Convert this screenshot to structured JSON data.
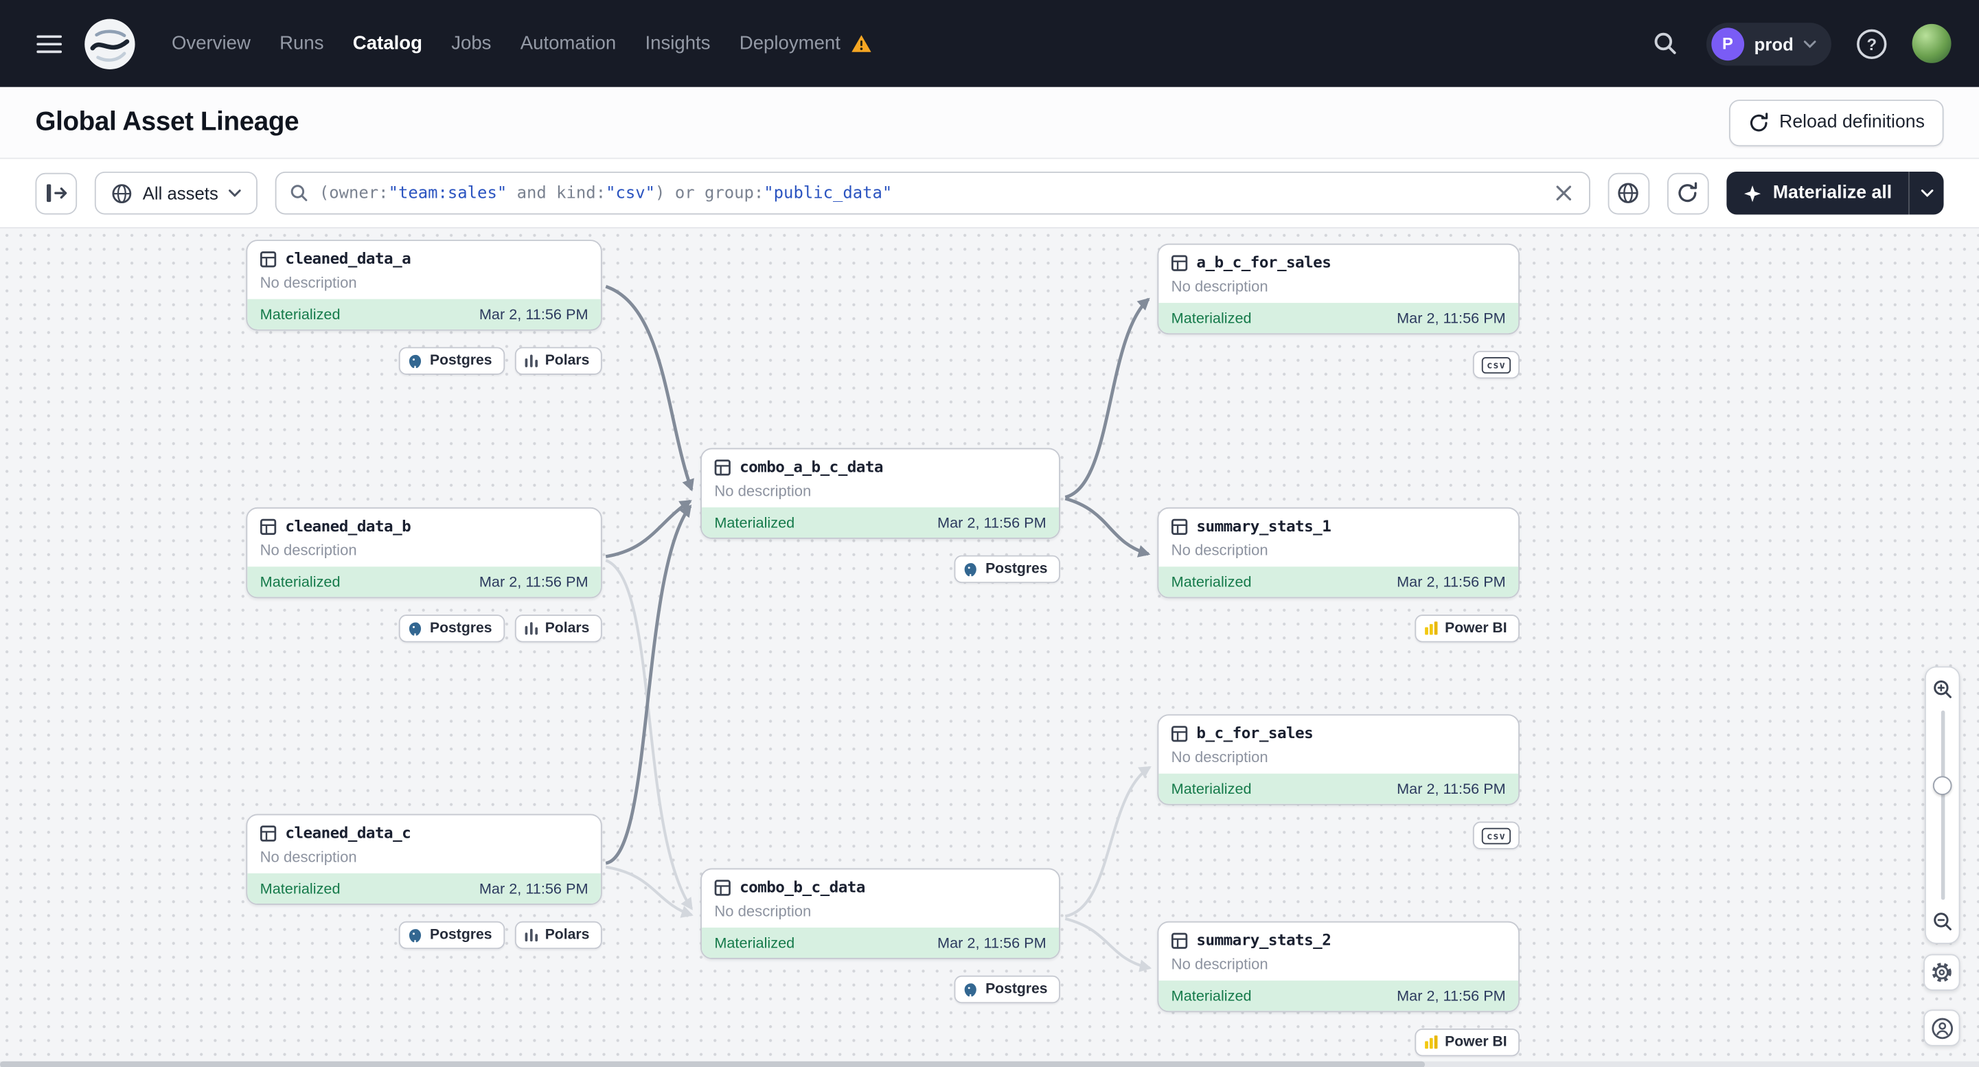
{
  "colors": {
    "nav_bg": "#171b26",
    "materialized_bg": "#d7f0e1",
    "materialized_text": "#157a4a",
    "query_string_blue": "#2b54c0",
    "warning_orange": "#f5a623",
    "materialize_button_bg": "#1e2433",
    "postgres_blue": "#336791",
    "powerbi_yellow": "#f2c811"
  },
  "nav": {
    "items": [
      {
        "label": "Overview"
      },
      {
        "label": "Runs"
      },
      {
        "label": "Catalog"
      },
      {
        "label": "Jobs"
      },
      {
        "label": "Automation"
      },
      {
        "label": "Insights"
      },
      {
        "label": "Deployment"
      }
    ],
    "deployment_pill": {
      "initial": "P",
      "name": "prod"
    }
  },
  "header": {
    "title": "Global Asset Lineage",
    "reload_button": "Reload definitions"
  },
  "toolbar": {
    "filter": {
      "label": "All assets"
    },
    "search": {
      "tokens": [
        {
          "text": "(owner:",
          "type": "plain"
        },
        {
          "text": "\"team:sales\"",
          "type": "string"
        },
        {
          "text": " and kind:",
          "type": "plain"
        },
        {
          "text": "\"csv\"",
          "type": "string"
        },
        {
          "text": ") or group:",
          "type": "plain"
        },
        {
          "text": "\"public_data\"",
          "type": "string"
        }
      ]
    },
    "materialize": {
      "label": "Materialize all"
    }
  },
  "graph": {
    "description": "No description",
    "status_label": "Materialized",
    "timestamp": "Mar 2, 11:56 PM",
    "nodes": [
      {
        "name": "cleaned_data_a",
        "tags": [
          "Postgres",
          "Polars"
        ]
      },
      {
        "name": "cleaned_data_b",
        "tags": [
          "Postgres",
          "Polars"
        ]
      },
      {
        "name": "cleaned_data_c",
        "tags": [
          "Postgres",
          "Polars"
        ]
      },
      {
        "name": "combo_a_b_c_data",
        "tags": [
          "Postgres"
        ]
      },
      {
        "name": "combo_b_c_data",
        "tags": [
          "Postgres"
        ]
      },
      {
        "name": "a_b_c_for_sales",
        "tags": [
          "csv"
        ]
      },
      {
        "name": "summary_stats_1",
        "tags": [
          "Power BI"
        ]
      },
      {
        "name": "b_c_for_sales",
        "tags": [
          "csv"
        ]
      },
      {
        "name": "summary_stats_2",
        "tags": [
          "Power BI"
        ]
      }
    ]
  }
}
